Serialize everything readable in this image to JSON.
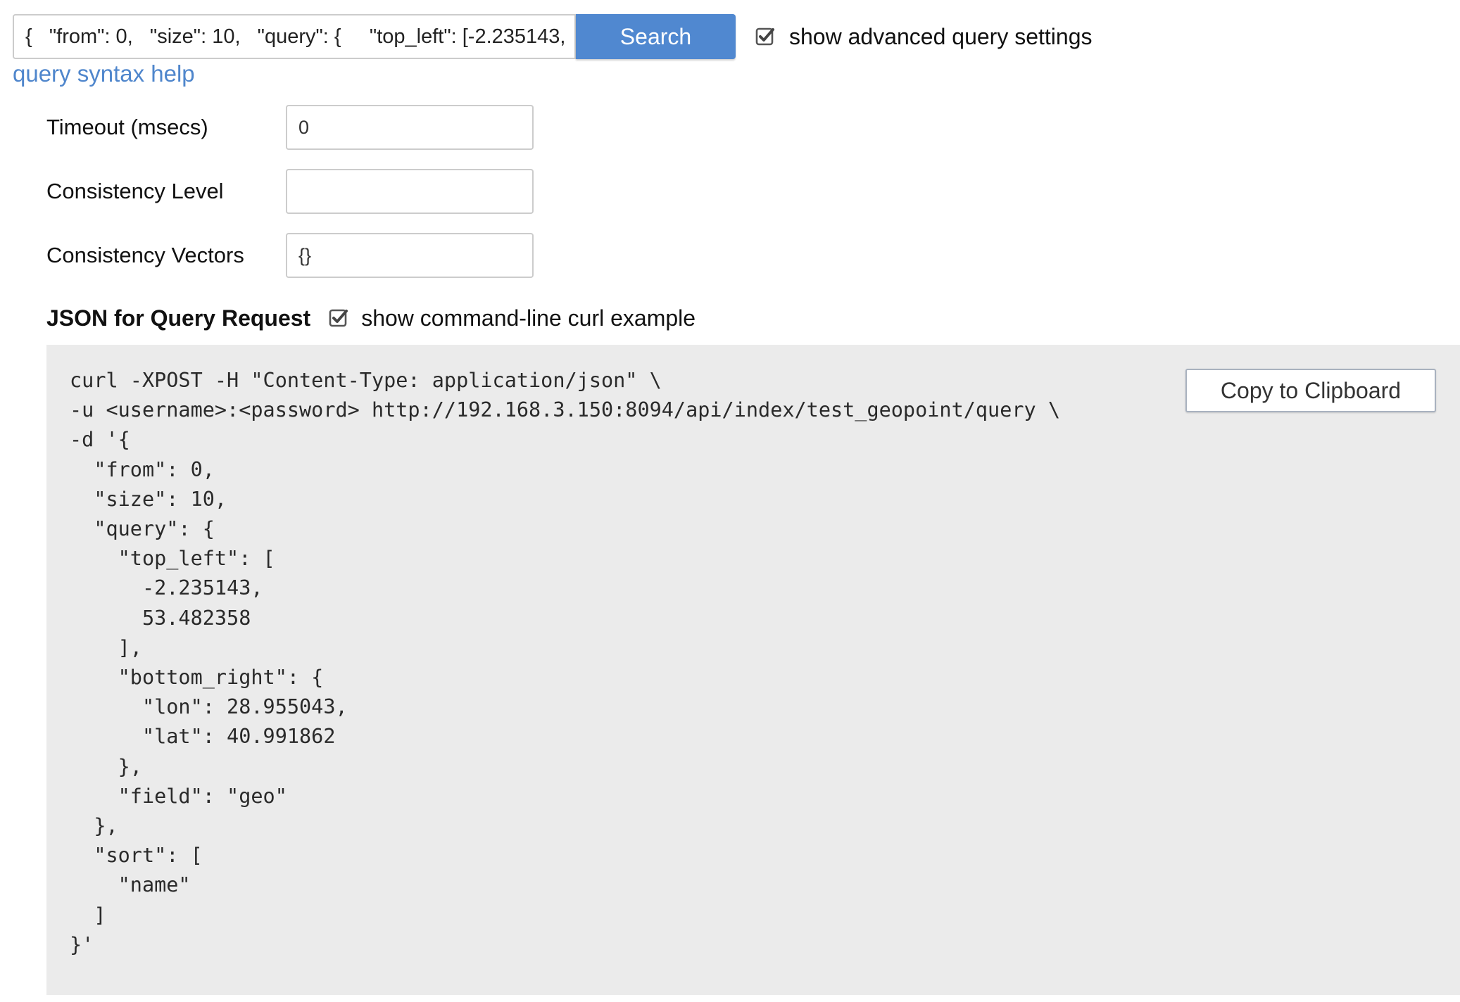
{
  "search": {
    "query_value": "{   \"from\": 0,   \"size\": 10,   \"query\": {     \"top_left\": [-2.235143,",
    "button_label": "Search",
    "advanced_toggle_label": "show advanced query settings",
    "advanced_toggle_checked": true,
    "help_link_label": "query syntax help"
  },
  "advanced": {
    "fields": [
      {
        "label": "Timeout (msecs)",
        "value": "0"
      },
      {
        "label": "Consistency Level",
        "value": ""
      },
      {
        "label": "Consistency Vectors",
        "value": "{}"
      }
    ]
  },
  "json_section": {
    "title": "JSON for Query Request",
    "curl_toggle_label": "show command-line curl example",
    "curl_toggle_checked": true,
    "copy_button_label": "Copy to Clipboard",
    "code": "curl -XPOST -H \"Content-Type: application/json\" \\\n-u <username>:<password> http://192.168.3.150:8094/api/index/test_geopoint/query \\\n-d '{\n  \"from\": 0,\n  \"size\": 10,\n  \"query\": {\n    \"top_left\": [\n      -2.235143,\n      53.482358\n    ],\n    \"bottom_right\": {\n      \"lon\": 28.955043,\n      \"lat\": 40.991862\n    },\n    \"field\": \"geo\"\n  },\n  \"sort\": [\n    \"name\"\n  ]\n}'"
  },
  "colors": {
    "accent": "#5088d0",
    "link": "#4f86cc",
    "code_background": "#ebebeb"
  }
}
